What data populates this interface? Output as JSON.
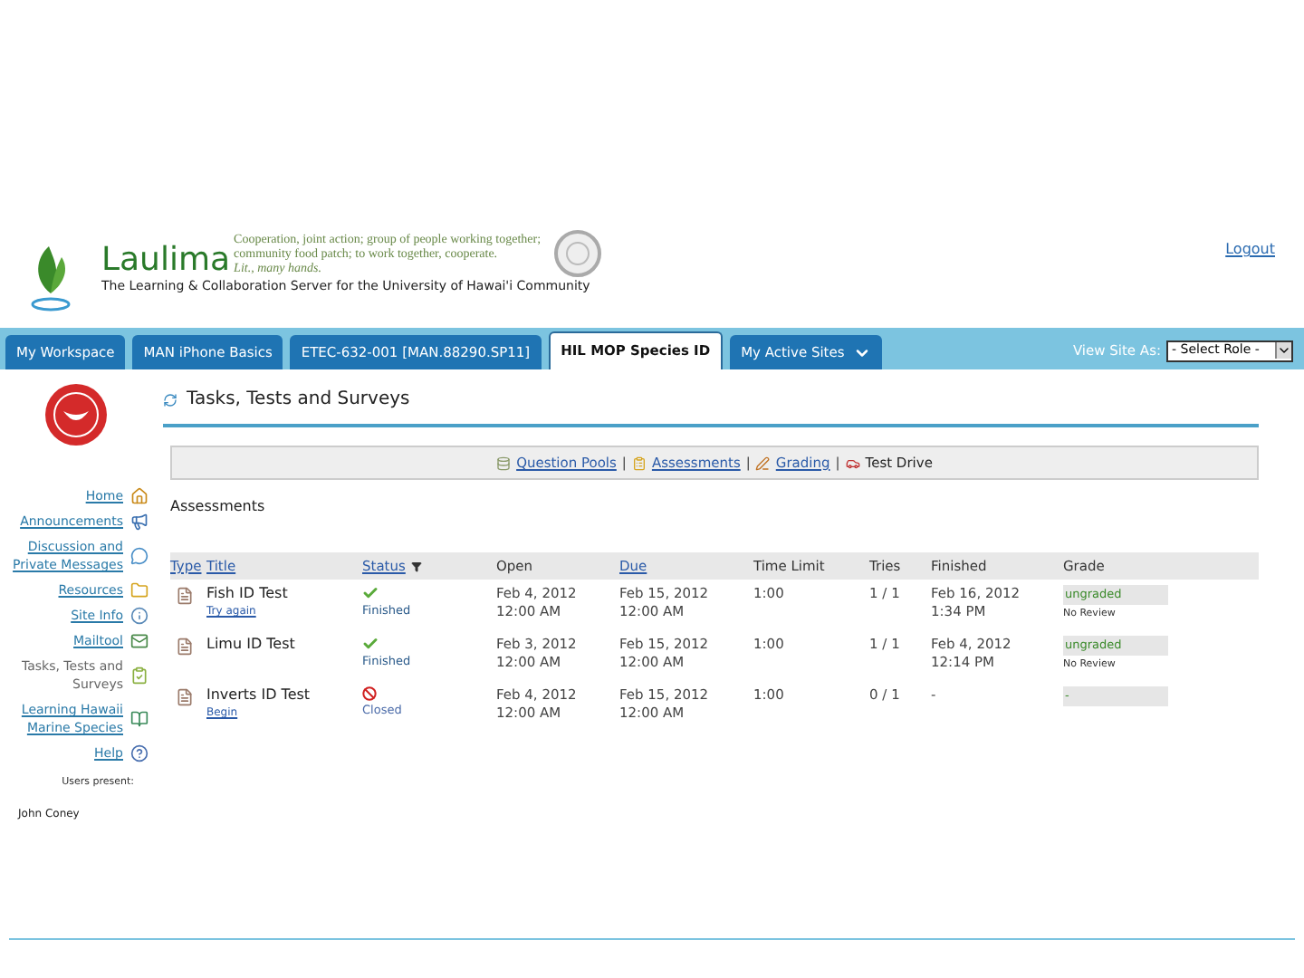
{
  "header": {
    "brand": "Laulima",
    "motto_lines": [
      "Cooperation, joint action; group of people working together;",
      "community food patch; to work together, cooperate."
    ],
    "motto_literal": "Lit., many hands.",
    "tagline": "The Learning & Collaboration Server for the University of Hawai'i Community",
    "logout": "Logout"
  },
  "tabs": [
    {
      "label": "My Workspace",
      "selected": false,
      "kind": "site"
    },
    {
      "label": "MAN iPhone Basics",
      "selected": false,
      "kind": "site"
    },
    {
      "label": "ETEC-632-001 [MAN.88290.SP11]",
      "selected": false,
      "kind": "site"
    },
    {
      "label": "HIL MOP Species ID",
      "selected": true,
      "kind": "site"
    },
    {
      "label": "My Active Sites",
      "selected": false,
      "kind": "menu"
    }
  ],
  "view_site_as": {
    "label": "View Site As:",
    "value": "- Select Role -"
  },
  "sidebar": {
    "items": [
      {
        "label": "Home",
        "selected": false
      },
      {
        "label": "Announcements",
        "selected": false
      },
      {
        "label": "Discussion and Private Messages",
        "selected": false
      },
      {
        "label": "Resources",
        "selected": false
      },
      {
        "label": "Site Info",
        "selected": false
      },
      {
        "label": "Mailtool",
        "selected": false
      },
      {
        "label": "Tasks, Tests and Surveys",
        "selected": true
      },
      {
        "label": "Learning Hawaii Marine Species",
        "selected": false
      },
      {
        "label": "Help",
        "selected": false
      }
    ],
    "users_present_label": "Users present:",
    "users": [
      "John Coney"
    ]
  },
  "page_title": "Tasks, Tests and Surveys",
  "toolbar": {
    "separator": "|",
    "items": [
      {
        "label": "Question Pools",
        "selected": false
      },
      {
        "label": "Assessments",
        "selected": false
      },
      {
        "label": "Grading",
        "selected": false
      },
      {
        "label": "Test Drive",
        "selected": true
      }
    ]
  },
  "section_title": "Assessments",
  "table": {
    "columns": [
      {
        "label": "Type",
        "sortable": true
      },
      {
        "label": "Title",
        "sortable": true
      },
      {
        "label": "Status",
        "sortable": true
      },
      {
        "label": "Open",
        "sortable": false
      },
      {
        "label": "Due",
        "sortable": true
      },
      {
        "label": "Time Limit",
        "sortable": false
      },
      {
        "label": "Tries",
        "sortable": false
      },
      {
        "label": "Finished",
        "sortable": false
      },
      {
        "label": "Grade",
        "sortable": false
      }
    ],
    "rows": [
      {
        "title": "Fish ID Test",
        "action": "Try again",
        "status": "Finished",
        "kind": "finished",
        "open": [
          "Feb 4, 2012",
          "12:00 AM"
        ],
        "due": [
          "Feb 15, 2012",
          "12:00 AM"
        ],
        "time_limit": "1:00",
        "tries": "1 / 1",
        "finished": [
          "Feb 16, 2012",
          "1:34 PM"
        ],
        "grade": "ungraded",
        "review": "No Review"
      },
      {
        "title": "Limu ID Test",
        "status": "Finished",
        "kind": "finished",
        "open": [
          "Feb 3, 2012",
          "12:00 AM"
        ],
        "due": [
          "Feb 15, 2012",
          "12:00 AM"
        ],
        "time_limit": "1:00",
        "tries": "1 / 1",
        "finished": [
          "Feb 4, 2012",
          "12:14 PM"
        ],
        "grade": "ungraded",
        "review": "No Review"
      },
      {
        "title": "Inverts ID Test",
        "action": "Begin",
        "status": "Closed",
        "kind": "closed",
        "open": [
          "Feb 4, 2012",
          "12:00 AM"
        ],
        "due": [
          "Feb 15, 2012",
          "12:00 AM"
        ],
        "time_limit": "1:00",
        "tries": "0 / 1",
        "finished": [
          "-"
        ],
        "grade": "-"
      }
    ]
  }
}
